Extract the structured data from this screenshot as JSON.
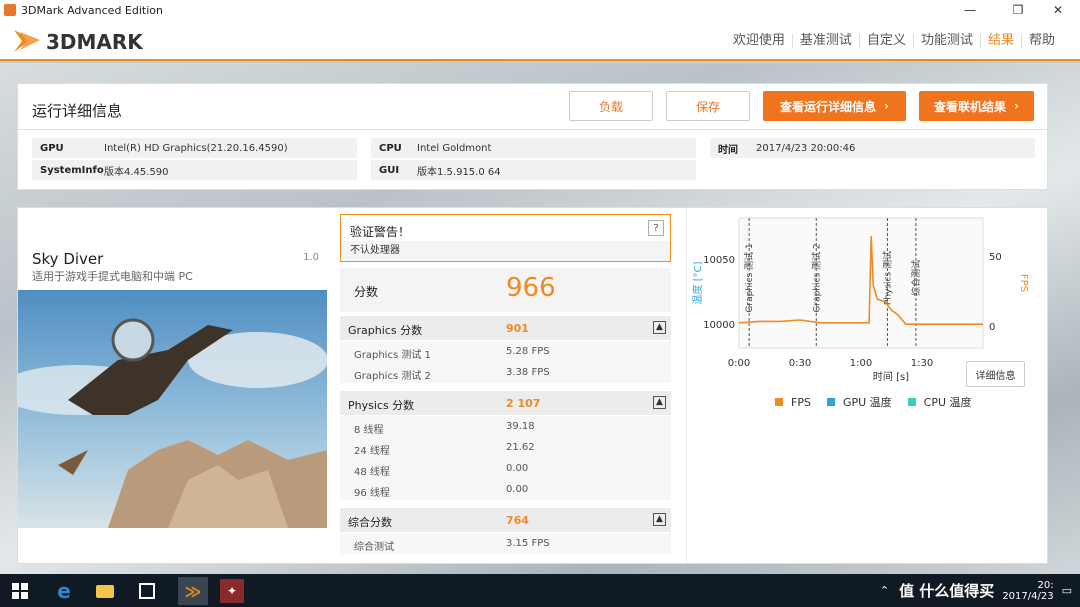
{
  "window": {
    "title": "3DMark Advanced Edition",
    "minimize_glyph": "—",
    "maximize_glyph": "❐",
    "close_glyph": "✕"
  },
  "app": {
    "logo_text": "3DMARK",
    "accent_color": "#f08a24"
  },
  "nav": {
    "items": [
      "欢迎使用",
      "基准测试",
      "自定义",
      "功能测试",
      "结果",
      "帮助"
    ],
    "active": "结果"
  },
  "details": {
    "title": "运行详细信息",
    "buttons": {
      "load": "负载",
      "save": "保存",
      "view_details": "查看运行详细信息",
      "view_online": "查看联机结果"
    },
    "info": {
      "gpu_label": "GPU",
      "gpu_value": "Intel(R) HD Graphics(21.20.16.4590)",
      "cpu_label": "CPU",
      "cpu_value": "Intel Goldmont",
      "time_label": "时间",
      "time_value": "2017/4/23 20:00:46",
      "sysinfo_label": "SystemInfo",
      "sysinfo_value": "版本4.45.590",
      "gui_label": "GUI",
      "gui_value": "版本1.5.915.0 64"
    }
  },
  "benchmark": {
    "name": "Sky Diver",
    "version": "1.0",
    "description": "适用于游戏手提式电脑和中端 PC"
  },
  "warning": {
    "title": "验证警告！",
    "help": "?",
    "detail": "不认处理器"
  },
  "score": {
    "label": "分数",
    "value": "966"
  },
  "graphics": {
    "label": "Graphics 分数",
    "value": "901",
    "collapse": "▲",
    "rows": [
      {
        "label": "Graphics 测试 1",
        "value": "5.28 FPS"
      },
      {
        "label": "Graphics 测试 2",
        "value": "3.38 FPS"
      }
    ]
  },
  "physics": {
    "label": "Physics 分数",
    "value": "2 107",
    "collapse": "▲",
    "rows": [
      {
        "label": "8 线程",
        "value": "39.18"
      },
      {
        "label": "24 线程",
        "value": "21.62"
      },
      {
        "label": "48 线程",
        "value": "0.00"
      },
      {
        "label": "96 线程",
        "value": "0.00"
      }
    ]
  },
  "combined": {
    "label": "综合分数",
    "value": "764",
    "collapse": "▲",
    "rows": [
      {
        "label": "综合测试",
        "value": "3.15 FPS"
      }
    ]
  },
  "chart": {
    "y_left_ticks": [
      "10050",
      "10000"
    ],
    "y_right_ticks": [
      "50",
      "0"
    ],
    "x_ticks": [
      "0:00",
      "0:30",
      "1:00",
      "1:30"
    ],
    "y_left_label": "温度 [°C]",
    "y_right_label": "FPS",
    "x_label": "时间 [s]",
    "phases": [
      "Graphics 测试 1",
      "Graphics 测试 2",
      "Physics 测试",
      "综合测试"
    ],
    "detail_button": "详细信息",
    "legend": [
      {
        "name": "FPS",
        "color": "#f08a24"
      },
      {
        "name": "GPU 温度",
        "color": "#2aa6df"
      },
      {
        "name": "CPU 温度",
        "color": "#33d1b7"
      }
    ]
  },
  "chart_data": {
    "type": "line",
    "xlabel": "时间 [s]",
    "ylabel": "温度 [°C]",
    "y2label": "FPS",
    "xlim": [
      0,
      120
    ],
    "y2lim": [
      -15,
      78
    ],
    "series": [
      {
        "name": "FPS",
        "x": [
          0,
          10,
          20,
          30,
          40,
          50,
          60,
          64,
          65,
          66,
          68,
          72,
          75,
          78,
          82,
          90,
          100,
          110,
          120
        ],
        "y": [
          3,
          4,
          4,
          5,
          3,
          3,
          3,
          3,
          65,
          30,
          20,
          18,
          12,
          9,
          2,
          2,
          2,
          2,
          2
        ]
      }
    ],
    "legend": [
      "FPS",
      "GPU 温度",
      "CPU 温度"
    ],
    "phases": [
      "Graphics 测试 1",
      "Graphics 测试 2",
      "Physics 测试",
      "综合测试"
    ]
  },
  "taskbar": {
    "time": "20:",
    "date": "2017/4/23",
    "watermark": "值 什么值得买"
  }
}
